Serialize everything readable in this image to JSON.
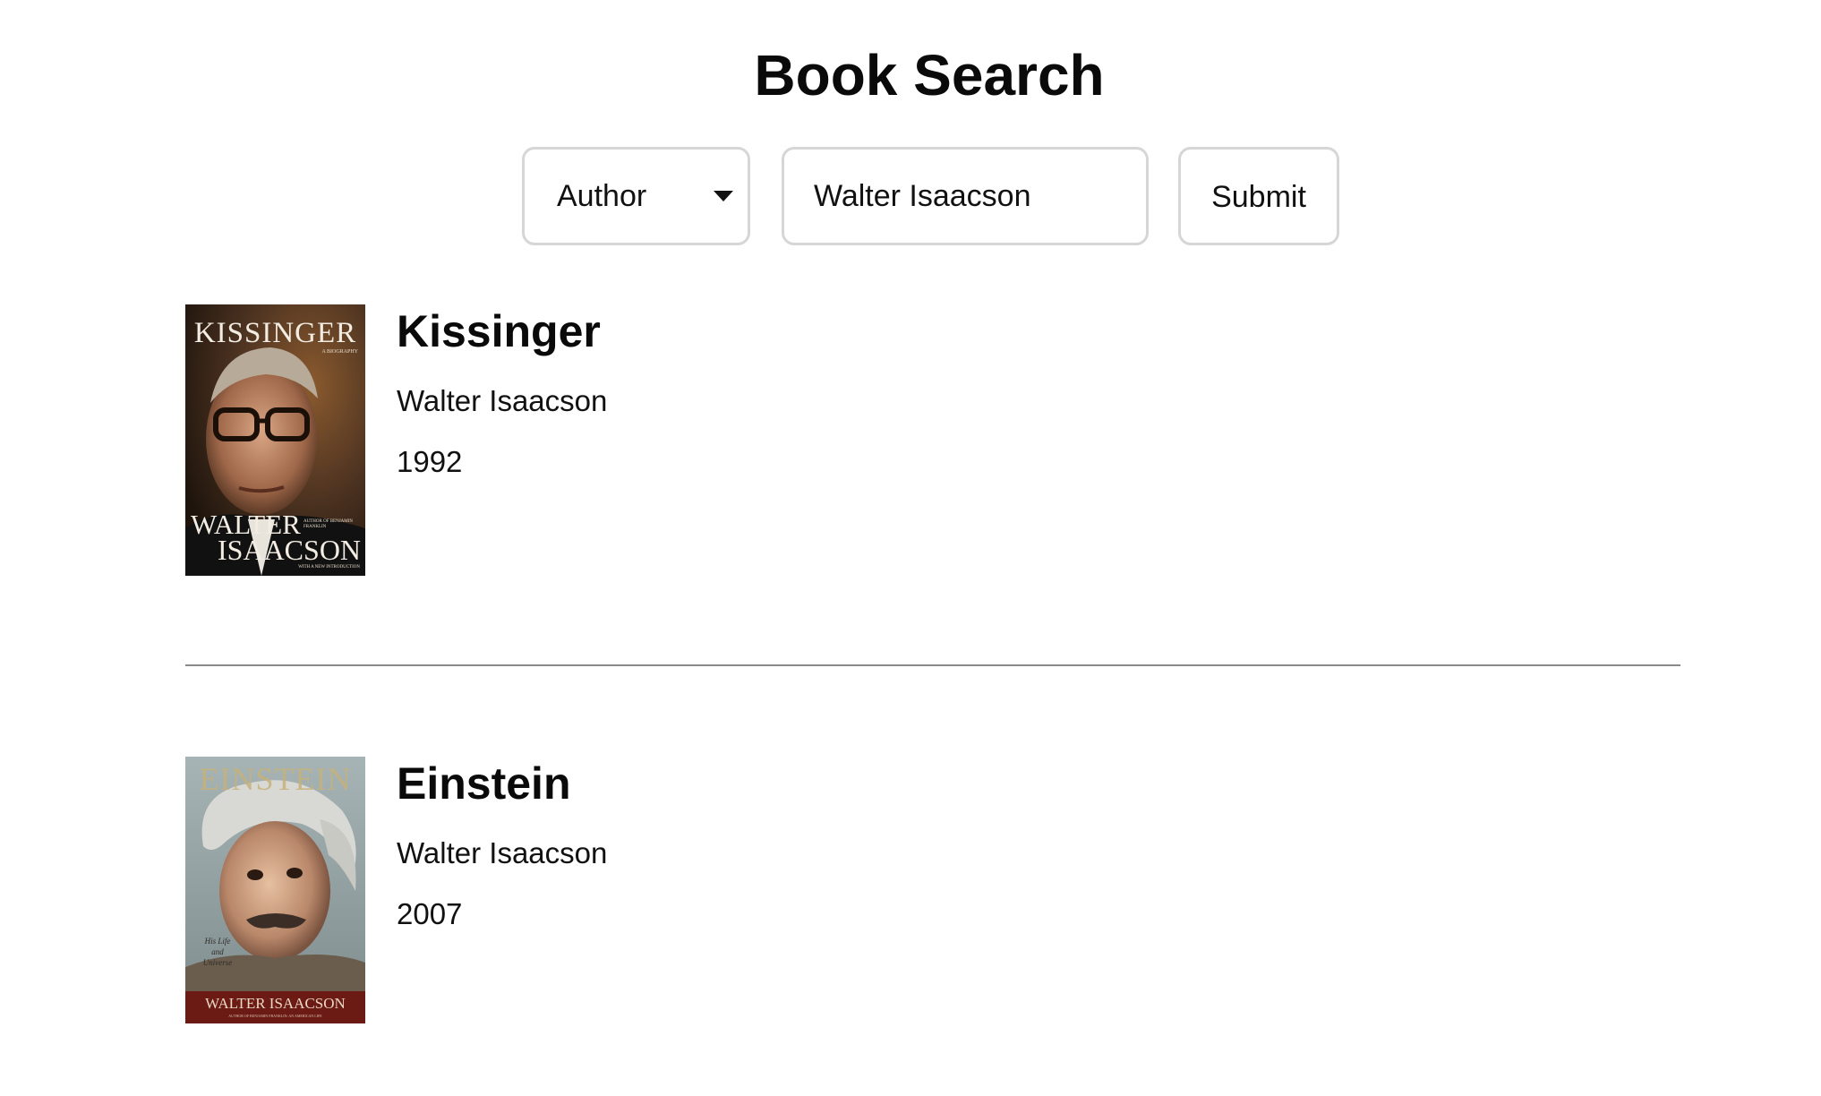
{
  "page": {
    "title": "Book Search"
  },
  "search": {
    "field_type": {
      "selected": "Author",
      "options": [
        "Author"
      ]
    },
    "query_value": "Walter Isaacson",
    "submit_label": "Submit"
  },
  "results": [
    {
      "title": "Kissinger",
      "author": "Walter Isaacson",
      "year": "1992",
      "cover": {
        "title_text": "KISSINGER",
        "subtitle_text": "A BIOGRAPHY",
        "author_line1": "WALTER",
        "author_line2": "ISAACSON",
        "blurb": "AUTHOR OF BENJAMIN FRANKLIN",
        "tagline": "WITH A NEW INTRODUCTION"
      }
    },
    {
      "title": "Einstein",
      "author": "Walter Isaacson",
      "year": "2007",
      "cover": {
        "title_text": "EINSTEIN",
        "subtitle_text": "His Life and Universe",
        "author_line1": "WALTER ISAACSON",
        "tagline": "AUTHOR OF BENJAMIN FRANKLIN: AN AMERICAN LIFE"
      }
    }
  ],
  "colors": {
    "border": "#d6d6d6",
    "divider": "#8a8a8a",
    "text": "#111111",
    "kissinger_cover_bg": "#3b2a1c",
    "einstein_cover_bg": "#8c9ba0",
    "einstein_cover_band": "#6b1a14"
  }
}
